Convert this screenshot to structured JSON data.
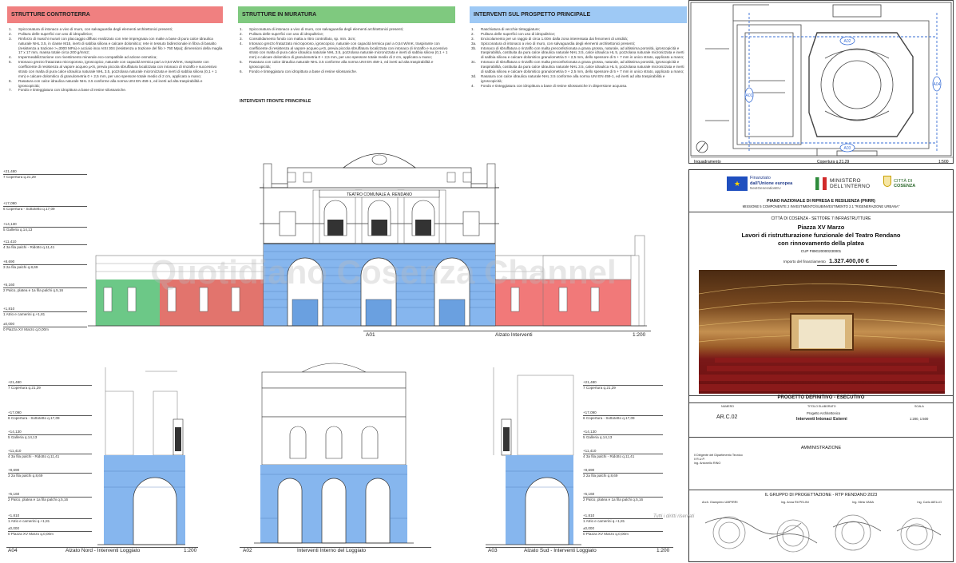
{
  "columns": {
    "controterra": {
      "header": "STRUTTURE CONTROTERRA",
      "color": "#f08080",
      "items": [
        {
          "n": "1.",
          "t": "Spicconatura di intonaco a vivo di muro, con salvaguardia degli elementi architettonici presenti;"
        },
        {
          "n": "2.",
          "t": "Pulitura delle superfici con uso di idropulitrice;"
        },
        {
          "n": "3.",
          "t": "Rinforzo di maschi murari con placcaggio diffuso realizzato con rete impregnata con malte a base di pura calce idraulica naturale NHL 3.5, in classe M15, inerti di sabbia silicea e calcare dolomitico; rete in tessuto bidirezionale in fibra di basalto (resistenza a trazione >=3000 MPa) e acciaio inox AISI 304 (resistenza a trazione del filo > 750 Mpa); dimensioni della maglia 17 x 17 mm, massa totale circa 200 g/mm2;"
        },
        {
          "n": "4.",
          "t": "Impermeabilizzazione con rivestimento minerale eco-compatibile ad azione osmotica;"
        },
        {
          "n": "5.",
          "t": "Intonaco grezzo fratazzato microporoso, igroscopico, naturale con capacità termica pari a 0,54 W/mK, traspirante con coefficiente di resistenza al vapore acqueo µ<6, previa piccola sbruffatura localizzata con intonaco di rinzaffo e successivo strato con malta di pura calce idraulica naturale NHL 3.5, pozzolana naturale micronizzata e inerti di sabbia silicea (0,1 + 1 mm) e calcare dolomitico di granulometria 0 + 2,5 mm, per uno spessore totale medio di 2 cm, applicato a mano;"
        },
        {
          "n": "6.",
          "t": "Rasatura con calce idraulica naturale NHL 3.5 conforme alla norma UNI EN 459-1, ed inerti ad alta traspirabilità e igroscopicità;"
        },
        {
          "n": "7.",
          "t": "Fondo e tinteggiatura con idropittura a base di resine silossaniche."
        }
      ]
    },
    "muratura": {
      "header": "STRUTTURE IN MURATURA",
      "color": "#7fc97f",
      "items": [
        {
          "n": "1.",
          "t": "Spicconatura di intonaco a vivo di muro, con salvaguardia degli elementi architettonici presenti;"
        },
        {
          "n": "2.",
          "t": "Pulitura delle superfici con uso di idropulitrice;"
        },
        {
          "n": "3.",
          "t": "Consolidamento fondo con malta a ritiro controllato, sp. min. 3cm;"
        },
        {
          "n": "4.",
          "t": "Intonaco grezzo fratazzato microporoso, igroscopico, naturale con capacità termica pari a 0,54 W/mK, traspirante con coefficiente di resistenza al vapore acqueo µ<6, previa piccola sbruffatura localizzata con intonaco di rinzaffo e successivo strato con malta di pura calce idraulica naturale NHL 3.5, pozzolana naturale micronizzata e inerti di sabbia silicea (0,1 + 1 mm) e calcare dolomitico di granulometria 0 + 2,5 mm, per uno spessore totale medio di 2 cm, applicato a mano;"
        },
        {
          "n": "5.",
          "t": "Rasatura con calce idraulica naturale NHL 3.5 conforme alla norma UNI EN 459-1, ed inerti ad alta traspirabilità e igroscopicità;"
        },
        {
          "n": "6.",
          "t": "Fondo e tinteggiatura con idropittura a base di resine silossaniche."
        }
      ],
      "subheader": "INTERVENTI FRONTE PRINCIPALE"
    },
    "prospetto": {
      "header": "INTERVENTI SUL PROSPETTO PRINCIPALE",
      "color": "#9ec9f5",
      "items": [
        {
          "n": "1.",
          "t": "Raschiatura di vecchie tinteggiature;"
        },
        {
          "n": "2.",
          "t": "Pulitura delle superfici con uso di idropulitrice;"
        },
        {
          "n": "3.",
          "t": "Encicolamento per un raggio di circa 1.00m dalla zona interessata dai fenomeni di umidità;"
        },
        {
          "n": "3a.",
          "t": "Spicconatura di intonaco a vivo di muro, con salvaguardia degli elementi architettonici presenti;"
        },
        {
          "n": "3b.",
          "t": "Intonaco di sbruffatura o rinzaffo con malta preconfezionata a grana grossa, naturale, ad altissima porosità, igroscopicità e traspirabilità, costituita da pura calce idraulica naturale NHL 3.5, calce idraulica HL 5, pozzolana naturale micronizzata e inerti di sabbia silicea e calcare dolomitico granulometria 0 + 2,5 mm, dello spessore di 5 + 7 mm in unico strato, applicato a mano;"
        },
        {
          "n": "3c.",
          "t": "Intonaco di sbruffatura o rinzaffo con malta preconfezionata a grana grossa, naturale, ad altissima porosità, igroscopicità e traspirabilità, costituita da pura calce idraulica naturale NHL 3.5, calce idraulica HL 5, pozzolana naturale micronizzata e inerti di sabbia silicea e calcare dolomitico granulometria 0 + 2,5 mm, dello spessore di 5 + 7 mm in unico strato, applicato a mano;"
        },
        {
          "n": "3d.",
          "t": "Rasatura con calce idraulica naturale NHL 3.5 conforme alla norma UNI EN 459-1, ed inerti ad alta traspirabilità e igroscopicità;"
        },
        {
          "n": "4.",
          "t": "Fondo e tinteggiatura con idropittura a base di resine silossaniche in dispersione acquosa."
        }
      ]
    }
  },
  "levels_main": [
    {
      "v": "+21,480",
      "l": "7 Copertura q.21,29"
    },
    {
      "v": "+17,090",
      "l": "6 Copertura - Sottotetto q.17,09"
    },
    {
      "v": "+14,130",
      "l": "5 Galleria q.14,13"
    },
    {
      "v": "+11,410",
      "l": "4 3a fila palchi - Ridotto q.11,41"
    },
    {
      "v": "+8,690",
      "l": "3 2a fila palchi q.8,69"
    },
    {
      "v": "+5,160",
      "l": "2 Palco, platea e 1a fila palchi q.5,16"
    },
    {
      "v": "+1,810",
      "l": "1 Atrio e camerini q.+1,81"
    },
    {
      "v": "±0,000",
      "l": "0 Piazza XV Marzo q.0,00m"
    }
  ],
  "drawing_labels": {
    "theatre_sign": "TEATRO COMUNALE A. RENDANO",
    "a01_code": "A01",
    "a01_title": "Alzato Interventi",
    "scale": "1:200",
    "a04_code": "A04",
    "a04_title": "Alzato Nord - Interventi Loggiato",
    "a02_code": "A02",
    "a02_title": "Interventi Interno del Loggiato",
    "a03_code": "A03",
    "a03_title": "Alzato Sud - Interventi Loggiato",
    "watermark": "Quotidiano Cosenza Channel"
  },
  "plan": {
    "title": "Inquadramento",
    "subtitle": "Copertura q.21,29",
    "scale": "1:500",
    "markers": [
      "A02",
      "A01",
      "A03",
      "A04"
    ]
  },
  "titleblock": {
    "eu_line1": "Finanziato",
    "eu_line2": "dall'Unione europea",
    "eu_line3": "NextGenerationEU",
    "ministry1": "MINISTERO",
    "ministry2": "DELL'INTERNO",
    "city1": "CITTÀ DI",
    "city2": "COSENZA",
    "pnrr": "PIANO NAZIONALE DI RIPRESA E RESILIENZA (PNRR)",
    "mission": "MISSIONE 5 COMPONENTE 2 INVESTIMENTO/SUBINVESTIMENTO 2.1 \"RIGENERAZIONE URBANA\"",
    "settore": "CITTÀ DI COSENZA - SETTORE 7 INFRASTRUTTURE",
    "place": "Piazza XV Marzo",
    "work1": "Lavori di ristrutturazione funzionale del Teatro Rendano",
    "work2": "con rinnovamento della platea",
    "cup": "CUP F89G20000230001",
    "importo_label": "Importo del finanziamento",
    "importo": "1.327.400,00 €",
    "phase": "PROGETTO DEFINITIVO - ESECUTIVO",
    "col_numero": "NUMERO",
    "col_titolo": "TITOLO ELABORATO",
    "col_scala": "SCALA",
    "code": "AR.C.02",
    "elab_type": "Progetto Architettonico",
    "elab_title": "Interventi Intonaci Esterni",
    "elab_scale": "1:200, 1:500",
    "admin": "AMMINISTRAZIONE",
    "admin1": "Il Dirigente del Dipartimento Tecnico",
    "admin2": "Il R.U.P.",
    "admin3": "ing. Antonello RINO",
    "group": "IL GRUPPO DI PROGETTAZIONE - RTP RENDANO 2023",
    "signers": [
      "Arch. Giampiero UMPIRRI",
      "Ing. Anna Rit PELINI",
      "Ing. Mirta VANA",
      "Ing. Carlo AIELLO"
    ],
    "rights": "Tutti i diritti riservati"
  },
  "colors": {
    "red": "#ef6a6a",
    "green": "#5cc27a",
    "blue": "#86b6ee",
    "blue_dark": "#6aa0e0"
  }
}
